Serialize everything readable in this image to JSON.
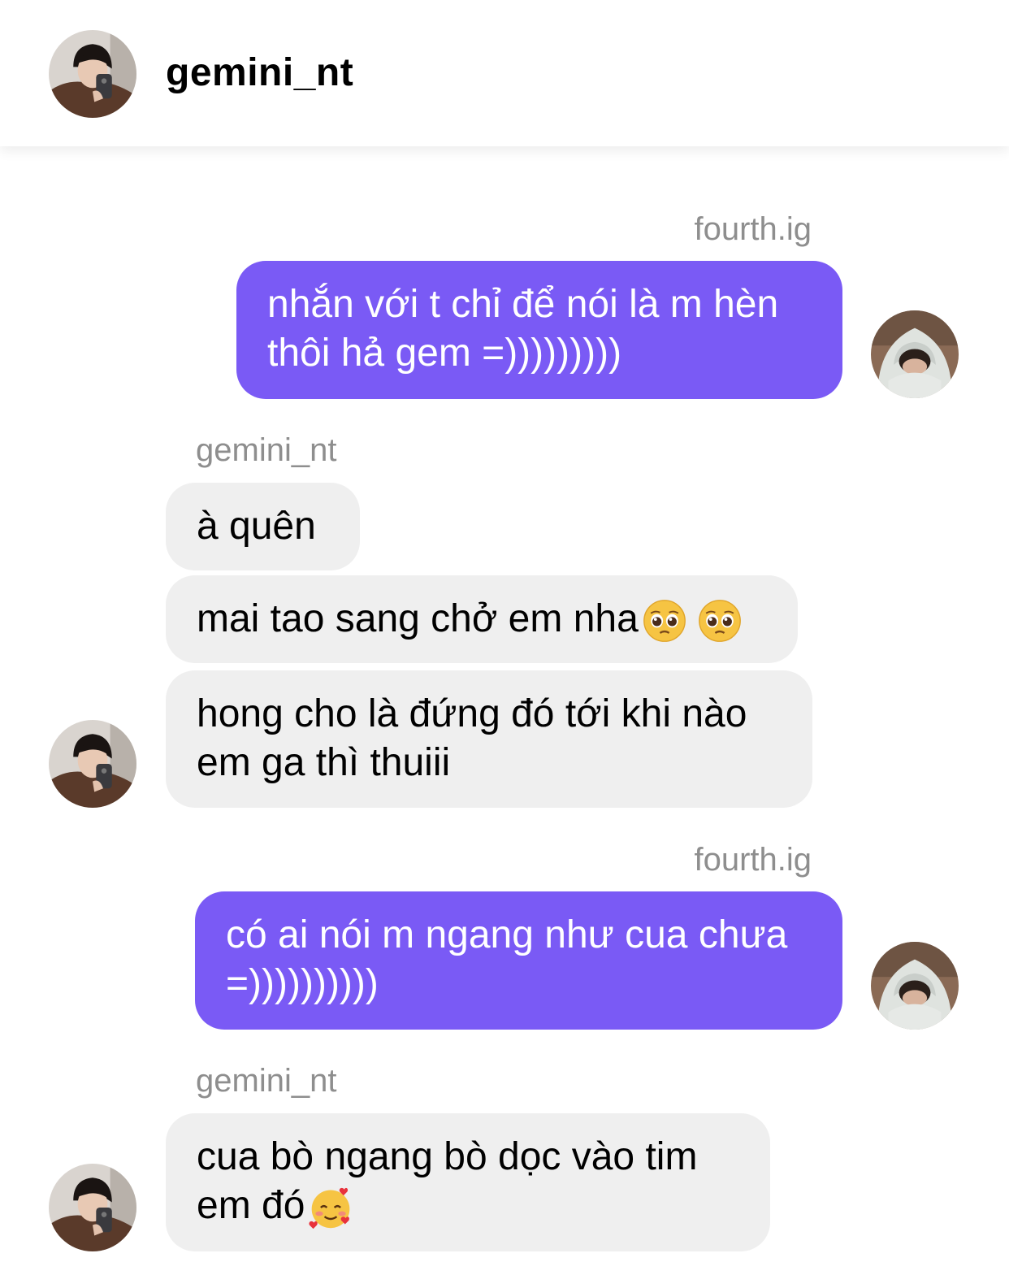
{
  "header": {
    "title": "gemini_nt",
    "avatar_icon": "profile-photo-avatar"
  },
  "messages": [
    {
      "sender": "fourth.ig",
      "direction": "outgoing",
      "lines": [
        "nhắn với t chỉ để nói là m hèn",
        "thôi hả gem =)))))))))"
      ]
    },
    {
      "sender": "gemini_nt",
      "direction": "incoming",
      "lines": [
        "à quên"
      ]
    },
    {
      "direction": "incoming",
      "lines": [
        "mai tao sang chở em nha"
      ],
      "emoji": [
        "pleading-face",
        "pleading-face"
      ]
    },
    {
      "direction": "incoming",
      "lines": [
        "hong cho là đứng đó tới khi nào",
        "em ga thì thuiii"
      ]
    },
    {
      "sender": "fourth.ig",
      "direction": "outgoing",
      "lines": [
        "có ai nói m ngang như cua chưa",
        "=))))))))))"
      ]
    },
    {
      "sender": "gemini_nt",
      "direction": "incoming",
      "lines": [
        "cua bò ngang bò dọc vào tim",
        "em đó"
      ],
      "emoji": [
        "smiling-face-with-hearts"
      ]
    }
  ],
  "colors": {
    "outgoing_bubble": "#7a5af5",
    "incoming_bubble": "#efefef",
    "sender_label": "#8e8e8e"
  }
}
